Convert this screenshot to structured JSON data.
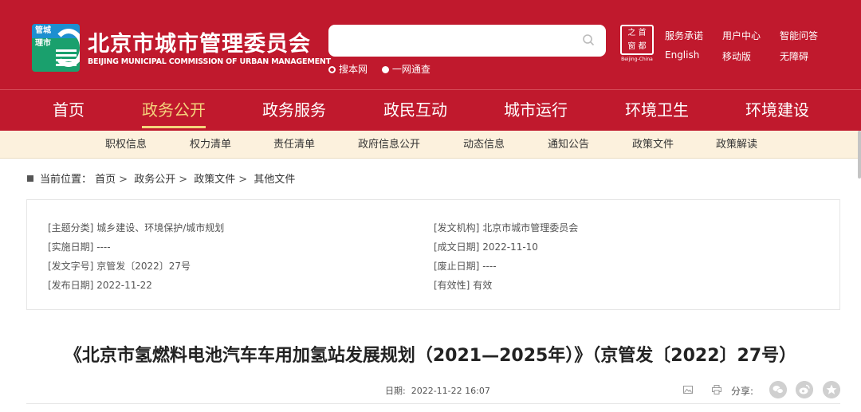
{
  "header": {
    "logo_text_top": "管城",
    "logo_text_bottom": "理市",
    "org_title": "北京市城市管理委员会",
    "org_en": "BEIJING MUNICIPAL COMMISSION OF URBAN MANAGEMENT",
    "search": {
      "placeholder": "",
      "options": [
        {
          "label": "搜本网",
          "selected": false
        },
        {
          "label": "一网通查",
          "selected": true
        }
      ]
    },
    "seal": {
      "chars": [
        "之",
        "首",
        "窗",
        "都"
      ],
      "en": "Beijing-China"
    },
    "links": [
      "服务承诺",
      "用户中心",
      "智能问答",
      "English",
      "移动版",
      "无障碍"
    ]
  },
  "main_nav": [
    "首页",
    "政务公开",
    "政务服务",
    "政民互动",
    "城市运行",
    "环境卫生",
    "环境建设"
  ],
  "main_nav_active_index": 1,
  "sub_nav": [
    "职权信息",
    "权力清单",
    "责任清单",
    "政府信息公开",
    "动态信息",
    "通知公告",
    "政策文件",
    "政策解读"
  ],
  "breadcrumb": {
    "label": "当前位置：",
    "items": [
      "首页",
      "政务公开",
      "政策文件",
      "其他文件"
    ],
    "separator": ">"
  },
  "info": {
    "left": [
      {
        "key": "[主题分类]",
        "value": "城乡建设、环境保护/城市规划"
      },
      {
        "key": "[实施日期]",
        "value": "----"
      },
      {
        "key": "[发文字号]",
        "value": "京管发〔2022〕27号"
      },
      {
        "key": "[发布日期]",
        "value": "2022-11-22"
      }
    ],
    "right": [
      {
        "key": "[发文机构]",
        "value": "北京市城市管理委员会"
      },
      {
        "key": "[成文日期]",
        "value": "2022-11-10"
      },
      {
        "key": "[废止日期]",
        "value": "----"
      },
      {
        "key": "[有效性]",
        "value": "有效"
      }
    ]
  },
  "article": {
    "title": "《北京市氢燃料电池汽车车用加氢站发展规划（2021—2025年）》（京管发〔2022〕27号）",
    "date_label": "日期:",
    "date_value": "2022-11-22 16:07",
    "share_label": "分享:"
  },
  "colors": {
    "brand_red": "#c0192d",
    "nav_active": "#f4d47c",
    "subnav_bg": "#fcf1dd"
  },
  "icons": [
    "search-icon",
    "picture-icon",
    "print-icon",
    "wechat-icon",
    "weibo-icon",
    "favorite-icon"
  ]
}
